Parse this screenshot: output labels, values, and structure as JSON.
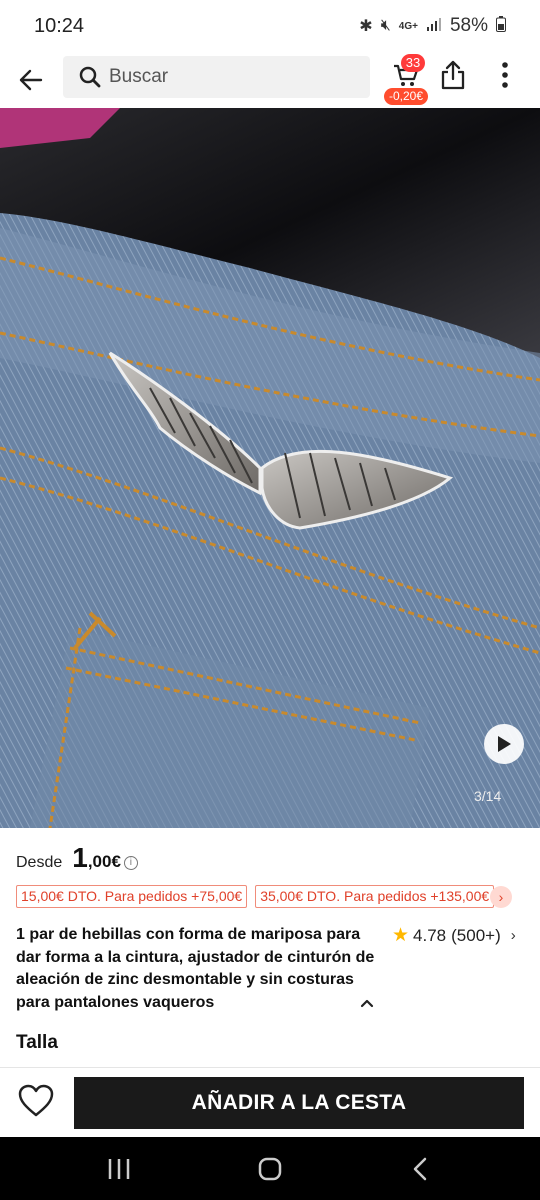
{
  "status_bar": {
    "time": "10:24",
    "network": "4G+",
    "battery": "58%"
  },
  "search": {
    "placeholder": "Buscar"
  },
  "cart": {
    "count": "33",
    "discount": "-0,20€"
  },
  "gallery": {
    "counter": "3/14"
  },
  "price": {
    "from_label": "Desde",
    "integer": "1",
    "decimal": ",00€"
  },
  "coupons": [
    "15,00€ DTO. Para pedidos +75,00€",
    "35,00€ DTO. Para pedidos +135,00€"
  ],
  "product": {
    "title": "1 par de hebillas con forma de mariposa para dar forma a la cintura, ajustador de cinturón de aleación de zinc desmontable y sin costuras para pantalones vaqueros",
    "rating": "4.78",
    "review_count": "(500+)"
  },
  "size_section": {
    "label": "Talla"
  },
  "actions": {
    "add_to_cart": "AÑADIR A LA CESTA"
  },
  "colors": {
    "accent_red": "#ff3a3a",
    "coupon_red": "#e0412a",
    "button_dark": "#1a1a1a",
    "star_gold": "#ffb800"
  }
}
